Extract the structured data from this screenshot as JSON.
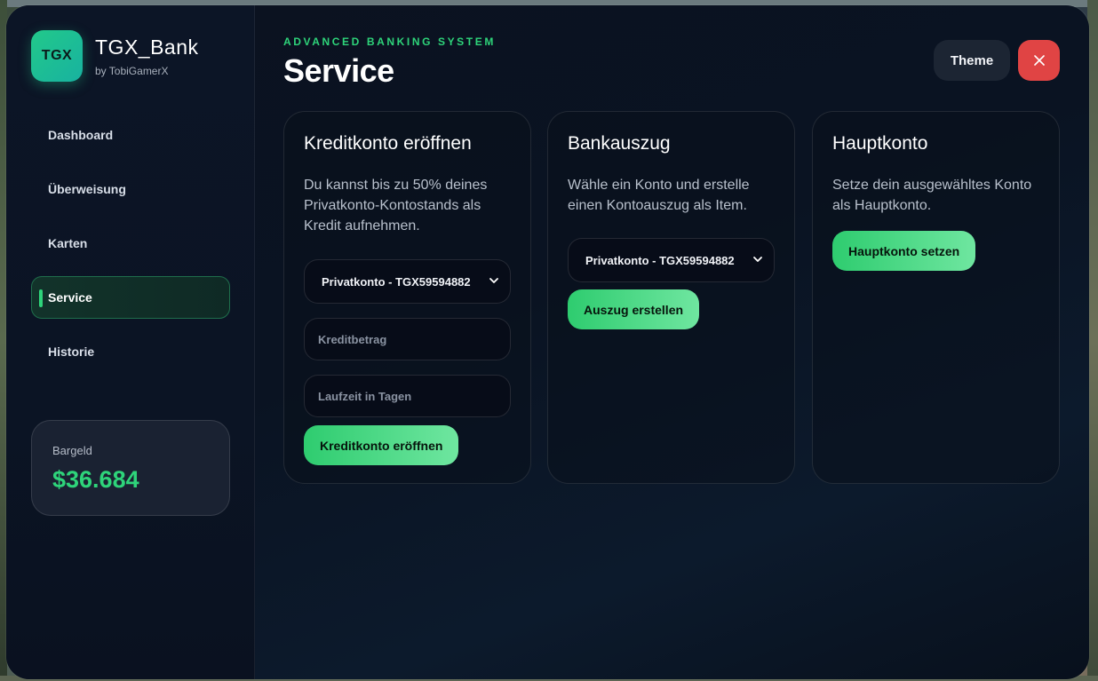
{
  "brand": {
    "logo_text": "TGX",
    "title": "TGX_Bank",
    "subtitle": "by TobiGamerX"
  },
  "nav": {
    "items": [
      {
        "label": "Dashboard"
      },
      {
        "label": "Überweisung"
      },
      {
        "label": "Karten"
      },
      {
        "label": "Service",
        "active": true
      },
      {
        "label": "Historie"
      }
    ]
  },
  "cash": {
    "label": "Bargeld",
    "value": "$36.684"
  },
  "header": {
    "eyebrow": "ADVANCED BANKING SYSTEM",
    "title": "Service",
    "theme_label": "Theme",
    "close_icon": "close-icon"
  },
  "cards": {
    "credit": {
      "title": "Kreditkonto eröffnen",
      "description": "Du kannst bis zu 50% deines Privatkonto-Kontostands als Kredit aufnehmen.",
      "account_select": "Privatkonto - TGX59594882",
      "amount_placeholder": "Kreditbetrag",
      "days_placeholder": "Laufzeit in Tagen",
      "button": "Kreditkonto eröffnen"
    },
    "statement": {
      "title": "Bankauszug",
      "description": "Wähle ein Konto und erstelle einen Kontoauszug als Item.",
      "account_select": "Privatkonto - TGX59594882",
      "button": "Auszug erstellen"
    },
    "main_account": {
      "title": "Hauptkonto",
      "description": "Setze dein ausgewähltes Konto als Hauptkonto.",
      "button": "Hauptkonto setzen"
    }
  },
  "colors": {
    "accent": "#2ed47a",
    "danger": "#e04444",
    "background": "#0b1220"
  }
}
